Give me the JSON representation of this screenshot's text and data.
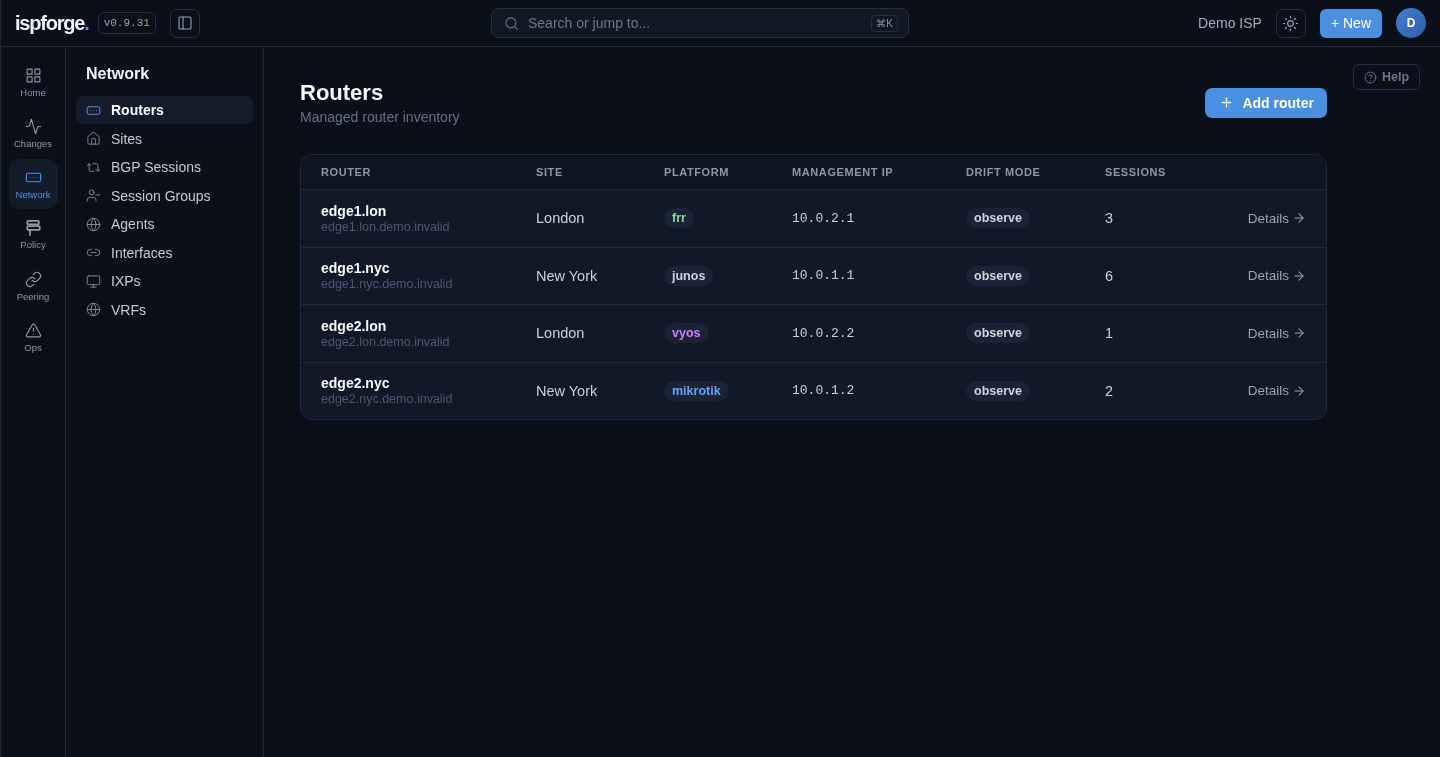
{
  "topbar": {
    "logo": {
      "name": "ispforge",
      "dot": "."
    },
    "version": "v0.9.31",
    "search": {
      "placeholder": "Search or jump to...",
      "shortcut": "⌘K"
    },
    "org": "Demo ISP",
    "new_button": "+ New",
    "avatar": "D"
  },
  "rail": [
    {
      "label": "Home",
      "selected": false
    },
    {
      "label": "Changes",
      "selected": false
    },
    {
      "label": "Network",
      "selected": true
    },
    {
      "label": "Policy",
      "selected": false
    },
    {
      "label": "Peering",
      "selected": false
    },
    {
      "label": "Ops",
      "selected": false
    }
  ],
  "sidebar": {
    "title": "Network",
    "items": [
      {
        "label": "Routers",
        "selected": true
      },
      {
        "label": "Sites",
        "selected": false
      },
      {
        "label": "BGP Sessions",
        "selected": false
      },
      {
        "label": "Session Groups",
        "selected": false
      },
      {
        "label": "Agents",
        "selected": false
      },
      {
        "label": "Interfaces",
        "selected": false
      },
      {
        "label": "IXPs",
        "selected": false
      },
      {
        "label": "VRFs",
        "selected": false
      }
    ]
  },
  "page": {
    "title": "Routers",
    "subtitle": "Managed router inventory",
    "add_button": "Add router",
    "help_button": "Help"
  },
  "table": {
    "columns": [
      "ROUTER",
      "SITE",
      "PLATFORM",
      "MANAGEMENT IP",
      "DRIFT MODE",
      "SESSIONS"
    ],
    "rows": [
      {
        "name": "edge1.lon",
        "host": "edge1.lon.demo.invalid",
        "site": "London",
        "platform": {
          "label": "frr",
          "color": "#86d99a"
        },
        "ip": "10.0.2.1",
        "drift_mode": "observe",
        "sessions": "3",
        "action": "Details"
      },
      {
        "name": "edge1.nyc",
        "host": "edge1.nyc.demo.invalid",
        "site": "New York",
        "platform": {
          "label": "junos",
          "color": "#cbd5e1"
        },
        "ip": "10.0.1.1",
        "drift_mode": "observe",
        "sessions": "6",
        "action": "Details"
      },
      {
        "name": "edge2.lon",
        "host": "edge2.lon.demo.invalid",
        "site": "London",
        "platform": {
          "label": "vyos",
          "color": "#c084fc"
        },
        "ip": "10.0.2.2",
        "drift_mode": "observe",
        "sessions": "1",
        "action": "Details"
      },
      {
        "name": "edge2.nyc",
        "host": "edge2.nyc.demo.invalid",
        "site": "New York",
        "platform": {
          "label": "mikrotik",
          "color": "#60a5fa"
        },
        "ip": "10.0.1.2",
        "drift_mode": "observe",
        "sessions": "2",
        "action": "Details"
      }
    ]
  }
}
